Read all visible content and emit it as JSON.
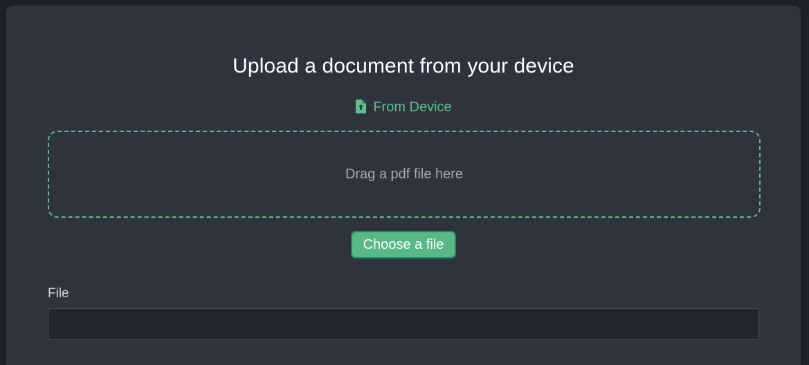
{
  "modal": {
    "title": "Upload a document from your device",
    "source_tab": {
      "label": "From Device",
      "icon": "file-upload-icon"
    },
    "dropzone": {
      "text": "Drag a pdf file here"
    },
    "choose_button": {
      "label": "Choose a file"
    },
    "file_field": {
      "label": "File",
      "value": ""
    }
  },
  "colors": {
    "accent": "#5fc08c",
    "button_bg": "#58b886",
    "modal_bg": "#2e333d",
    "page_bg": "#1e2129"
  }
}
